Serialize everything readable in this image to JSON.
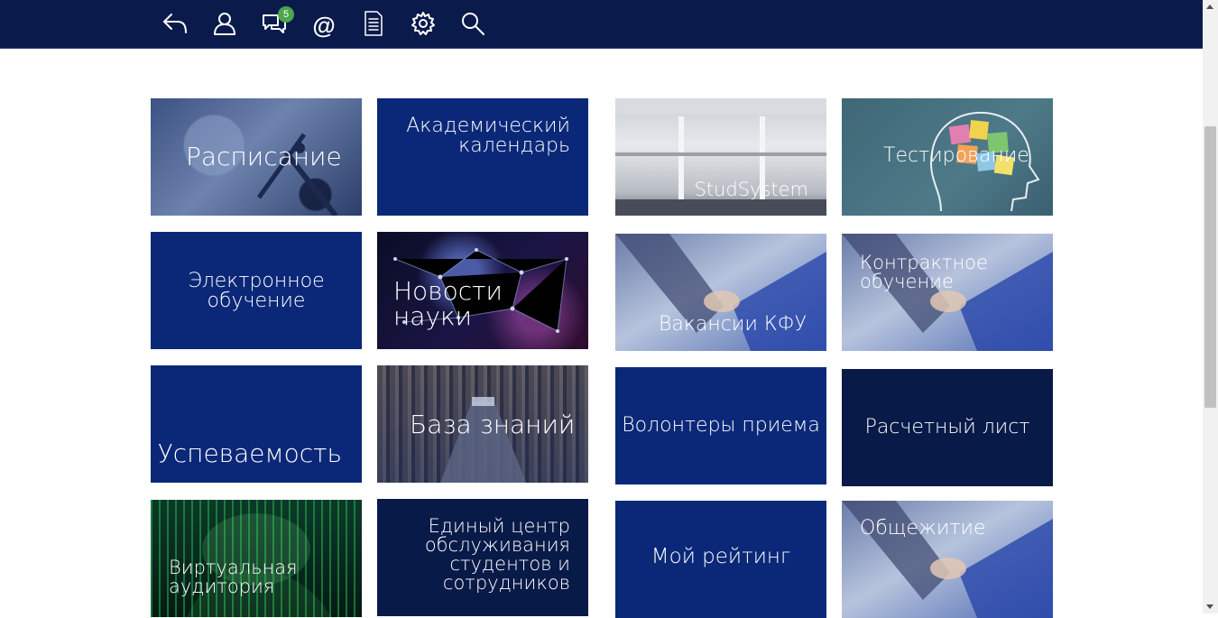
{
  "nav": {
    "messages_badge": "5",
    "at_symbol": "@"
  },
  "tiles": {
    "schedule": "Расписание",
    "academic_calendar": "Академический\nкалендарь",
    "studsystem": "StudSystem",
    "testing": "Тестирование",
    "elearning": "Электронное\nобучение",
    "science_news": "Новости науки",
    "vacancies": "Вакансии КФУ",
    "contract_education": "Контрактное\nобучение",
    "performance": "Успеваемость",
    "knowledge_base": "База знаний",
    "admission_volunteers": "Волонтеры приема",
    "payslip": "Расчетный лист",
    "virtual_classroom": "Виртуальная\nаудитория",
    "service_center": "Единый центр\nобслуживания\nстудентов и\nсотрудников",
    "my_rating": "Мой рейтинг",
    "dormitory": "Общежитие"
  },
  "icons": [
    "back-arrow-icon",
    "user-icon",
    "chat-icon",
    "at-icon",
    "document-icon",
    "gear-icon",
    "search-icon"
  ],
  "colors": {
    "topbar": "#0a1a4a",
    "tile_navy": "#0b2878",
    "tile_dark": "#081a48",
    "badge": "#4ea54a"
  }
}
